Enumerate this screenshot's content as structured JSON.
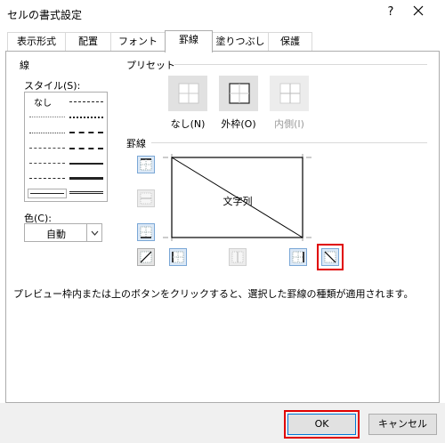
{
  "window": {
    "title": "セルの書式設定",
    "help_label": "?"
  },
  "tabs": [
    {
      "label": "表示形式"
    },
    {
      "label": "配置"
    },
    {
      "label": "フォント"
    },
    {
      "label": "罫線"
    },
    {
      "label": "塗りつぶし"
    },
    {
      "label": "保護"
    }
  ],
  "active_tab": "罫線",
  "line": {
    "group_label": "線",
    "style_label": "スタイル(S):",
    "none_label": "なし",
    "color_label": "色(C):",
    "color_value": "自動"
  },
  "presets": {
    "group_label": "プリセット",
    "items": [
      {
        "label": "なし(N)"
      },
      {
        "label": "外枠(O)"
      },
      {
        "label": "内側(I)"
      }
    ]
  },
  "border": {
    "group_label": "罫線",
    "preview_text": "文字列"
  },
  "help_text": "プレビュー枠内または上のボタンをクリックすると、選択した罫線の種類が適用されます。",
  "buttons": {
    "ok": "OK",
    "cancel": "キャンセル"
  },
  "colors": {
    "highlight": "#e00000",
    "selected_button": "#dbe8f6",
    "selected_border": "#7aa7d6"
  }
}
